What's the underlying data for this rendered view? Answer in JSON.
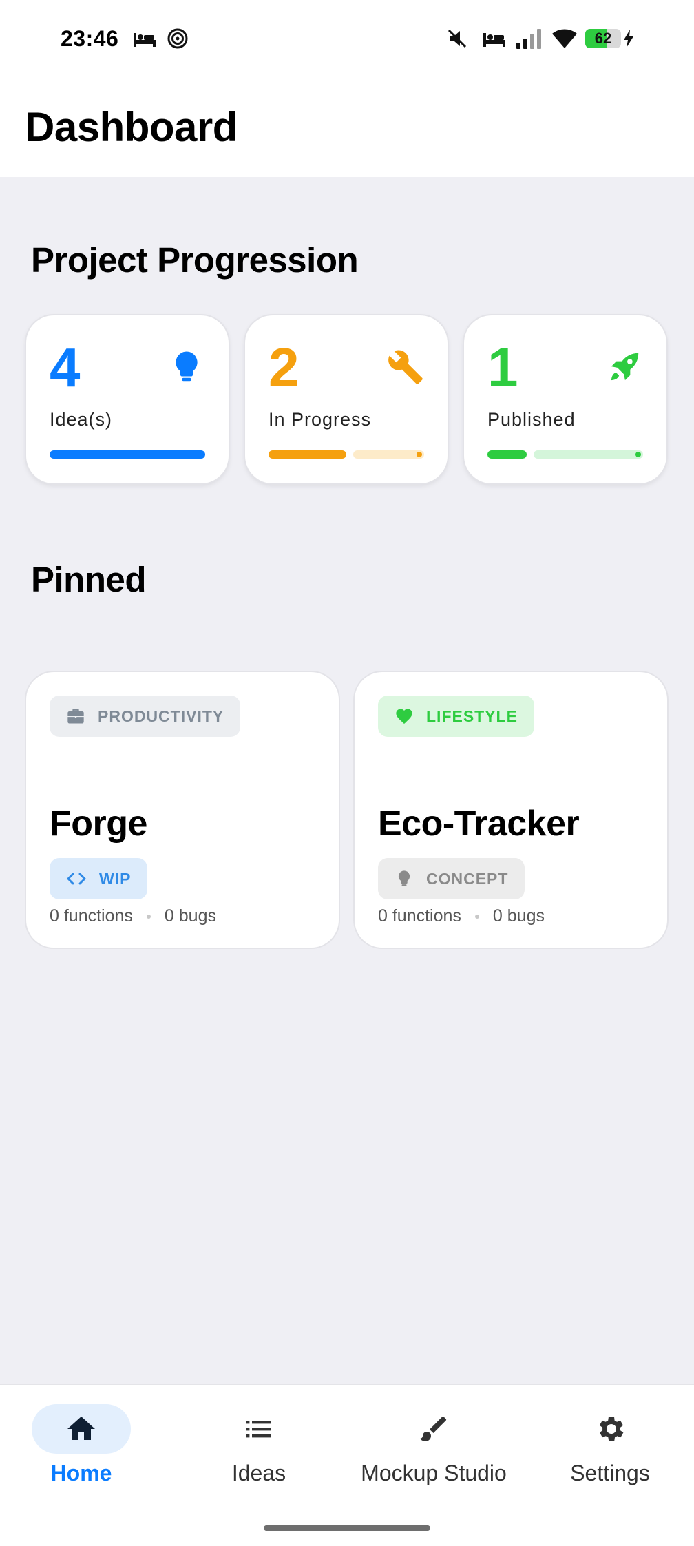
{
  "status_bar": {
    "time": "23:46",
    "battery_level": "62",
    "battery_fraction": 0.62,
    "icons": [
      "sleep-icon",
      "focus-mode-icon",
      "mute-icon",
      "sleep-icon",
      "signal-icon",
      "wifi-icon",
      "charging-icon"
    ]
  },
  "header": {
    "title": "Dashboard"
  },
  "progression": {
    "title": "Project Progression",
    "cards": [
      {
        "count": "4",
        "label": "Idea(s)",
        "icon": "lightbulb-icon",
        "color": "#0a7cff",
        "track_color": "#cfe4ff",
        "fraction": 1.0
      },
      {
        "count": "2",
        "label": "In Progress",
        "icon": "wrench-icon",
        "color": "#f5a00f",
        "track_color": "#fdebc9",
        "fraction": 0.5
      },
      {
        "count": "1",
        "label": "Published",
        "icon": "rocket-icon",
        "color": "#2ecc40",
        "track_color": "#d4f5da",
        "fraction": 0.25
      }
    ]
  },
  "pinned": {
    "title": "Pinned",
    "cards": [
      {
        "category": "PRODUCTIVITY",
        "category_icon": "briefcase-icon",
        "category_color": "#7f8a96",
        "category_bg": "#eceef1",
        "name": "Forge",
        "status": "WIP",
        "status_icon": "code-icon",
        "status_color": "#2f8ae6",
        "status_bg": "#dcebfb",
        "functions": "0 functions",
        "bugs": "0 bugs"
      },
      {
        "category": "LIFESTYLE",
        "category_icon": "heart-icon",
        "category_color": "#2ecc40",
        "category_bg": "#dcf7e0",
        "name": "Eco-Tracker",
        "status": "CONCEPT",
        "status_icon": "lightbulb-icon",
        "status_color": "#8a8a8a",
        "status_bg": "#ececec",
        "functions": "0 functions",
        "bugs": "0 bugs"
      }
    ]
  },
  "nav": {
    "items": [
      {
        "label": "Home",
        "icon": "home-icon",
        "active": true
      },
      {
        "label": "Ideas",
        "icon": "list-icon",
        "active": false
      },
      {
        "label": "Mockup Studio",
        "icon": "brush-icon",
        "active": false
      },
      {
        "label": "Settings",
        "icon": "gear-icon",
        "active": false
      }
    ],
    "active_color": "#0a7cff",
    "active_bg": "#e3effd"
  }
}
